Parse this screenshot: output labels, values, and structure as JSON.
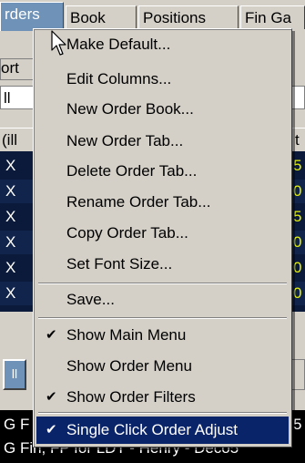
{
  "background": {
    "tabs": [
      "rders",
      "Book",
      "Positions",
      "Fin Ga"
    ],
    "subbar_left": "ort",
    "filter_value": "ll",
    "grid_header_left": "(ill",
    "grid_header_right": "t",
    "grid_rows": [
      {
        "kill": "X",
        "value": "5"
      },
      {
        "kill": "X",
        "value": "0"
      },
      {
        "kill": "X",
        "value": "5"
      },
      {
        "kill": "X",
        "value": "0"
      },
      {
        "kill": "X",
        "value": "0"
      },
      {
        "kill": "X",
        "value": "0"
      }
    ],
    "lower_button": "ll",
    "status_line_1": "G F",
    "status_line_1_right": "5",
    "status_line_2": "G Fin, FP for LDT - Henry - Deco5"
  },
  "menu": {
    "items": [
      {
        "label": "Make Default...",
        "checked": false
      },
      {
        "label": "Edit Columns...",
        "checked": false
      },
      {
        "label": "New Order Book...",
        "checked": false
      },
      {
        "label": "New Order Tab...",
        "checked": false
      },
      {
        "label": "Delete Order Tab...",
        "checked": false
      },
      {
        "label": "Rename Order Tab...",
        "checked": false
      },
      {
        "label": "Copy Order Tab...",
        "checked": false
      },
      {
        "label": "Set Font Size...",
        "checked": false
      },
      {
        "label": "Save...",
        "checked": false
      },
      {
        "label": "Show Main Menu",
        "checked": true
      },
      {
        "label": "Show Order Menu",
        "checked": false
      },
      {
        "label": "Show Order Filters",
        "checked": true
      },
      {
        "label": "Single Click Order Adjust",
        "checked": true
      }
    ],
    "check_glyph": "✔",
    "highlight_color": "#0a246a"
  }
}
